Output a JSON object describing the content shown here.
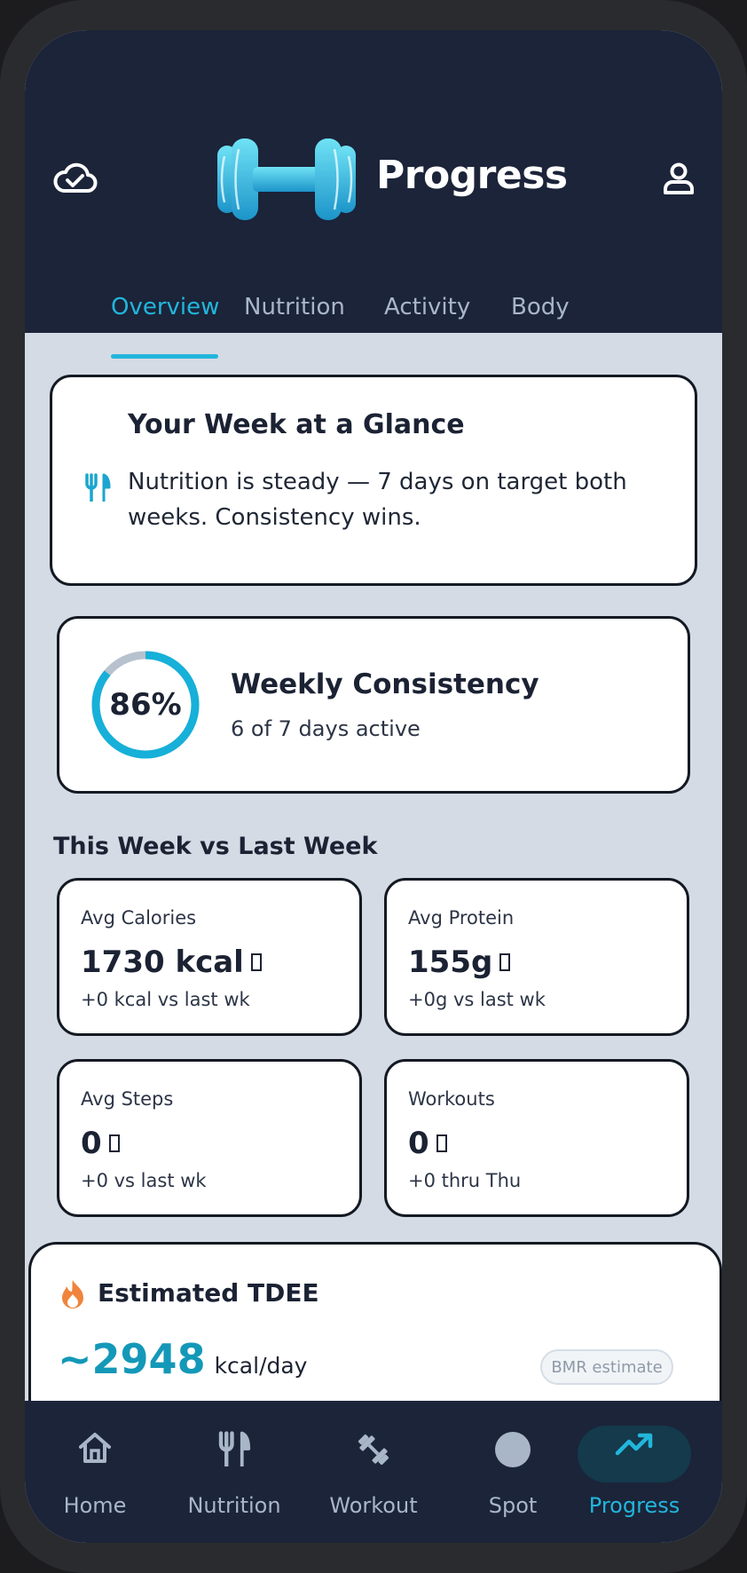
{
  "header": {
    "title": "Progress",
    "tabs": [
      {
        "label": "Overview",
        "active": true
      },
      {
        "label": "Nutrition",
        "active": false
      },
      {
        "label": "Activity",
        "active": false
      },
      {
        "label": "Body",
        "active": false
      }
    ]
  },
  "glance": {
    "title": "Your Week at a Glance",
    "icon": "utensils-icon",
    "text": "Nutrition is steady — 7 days on target both weeks. Consistency wins."
  },
  "consistency": {
    "percent_label": "86%",
    "percent": 0.86,
    "title": "Weekly Consistency",
    "subtitle": "6 of 7 days active"
  },
  "comparison": {
    "title": "This Week vs Last Week",
    "stats": [
      {
        "label": "Avg Calories",
        "value": "1730 kcal",
        "delta": "+0 kcal vs last wk"
      },
      {
        "label": "Avg Protein",
        "value": "155g",
        "delta": "+0g vs last wk"
      },
      {
        "label": "Avg Steps",
        "value": "0",
        "delta": "+0 vs last wk"
      },
      {
        "label": "Workouts",
        "value": "0",
        "delta": "+0 thru Thu"
      }
    ]
  },
  "tdee": {
    "icon": "flame-icon",
    "title": "Estimated TDEE",
    "value": "~2948",
    "unit": "kcal/day",
    "badge": "BMR estimate"
  },
  "nav": {
    "items": [
      {
        "label": "Home",
        "icon": "home-icon",
        "active": false
      },
      {
        "label": "Nutrition",
        "icon": "utensils-icon",
        "active": false
      },
      {
        "label": "Workout",
        "icon": "dumbbell-icon",
        "active": false
      },
      {
        "label": "Spot",
        "icon": "circle-icon",
        "active": false
      },
      {
        "label": "Progress",
        "icon": "trending-up-icon",
        "active": true
      }
    ]
  },
  "colors": {
    "accent": "#22b6dc",
    "header_bg": "#1b2439",
    "content_bg": "#d4dbe5",
    "flame": "#f0843c"
  }
}
